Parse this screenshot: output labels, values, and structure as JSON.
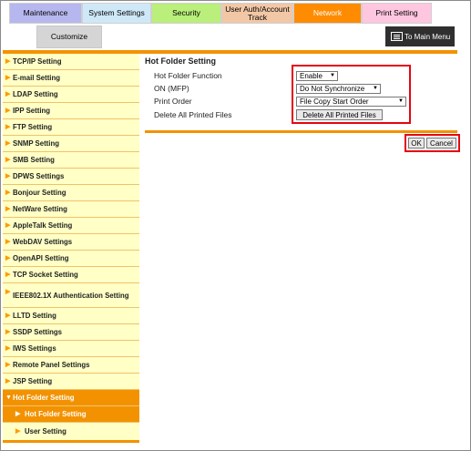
{
  "tabs": {
    "maintenance": "Maintenance",
    "system_settings": "System Settings",
    "security": "Security",
    "user_auth": "User Auth/Account Track",
    "network": "Network",
    "print_setting": "Print Setting",
    "customize": "Customize"
  },
  "main_menu": {
    "label": "To Main Menu",
    "icon": "menu-list-icon"
  },
  "sidebar": {
    "items": [
      {
        "label": "TCP/IP Setting"
      },
      {
        "label": "E-mail Setting"
      },
      {
        "label": "LDAP Setting"
      },
      {
        "label": "IPP Setting"
      },
      {
        "label": "FTP Setting"
      },
      {
        "label": "SNMP Setting"
      },
      {
        "label": "SMB Setting"
      },
      {
        "label": "DPWS Settings"
      },
      {
        "label": "Bonjour Setting"
      },
      {
        "label": "NetWare Setting"
      },
      {
        "label": "AppleTalk Setting"
      },
      {
        "label": "WebDAV Settings"
      },
      {
        "label": "OpenAPI Setting"
      },
      {
        "label": "TCP Socket Setting"
      },
      {
        "label": "IEEE802.1X Authentication Setting"
      },
      {
        "label": "LLTD Setting"
      },
      {
        "label": "SSDP Settings"
      },
      {
        "label": "IWS Settings"
      },
      {
        "label": "Remote Panel Settings"
      },
      {
        "label": "JSP Setting"
      },
      {
        "label": "Hot Folder Setting"
      },
      {
        "label": "Hot Folder Setting"
      },
      {
        "label": "User Setting"
      }
    ]
  },
  "content": {
    "title": "Hot Folder Setting",
    "rows": [
      {
        "label": "Hot Folder Function",
        "value": "Enable"
      },
      {
        "label": "ON (MFP)",
        "value": "Do Not Synchronize"
      },
      {
        "label": "Print Order",
        "value": "File Copy Start Order"
      },
      {
        "label": "Delete All Printed Files",
        "button": "Delete All Printed Files"
      }
    ],
    "ok": "OK",
    "cancel": "Cancel"
  },
  "colors": {
    "accent": "#f39200",
    "highlight": "#e30613",
    "sidebar_bg": "#ffffc6"
  }
}
